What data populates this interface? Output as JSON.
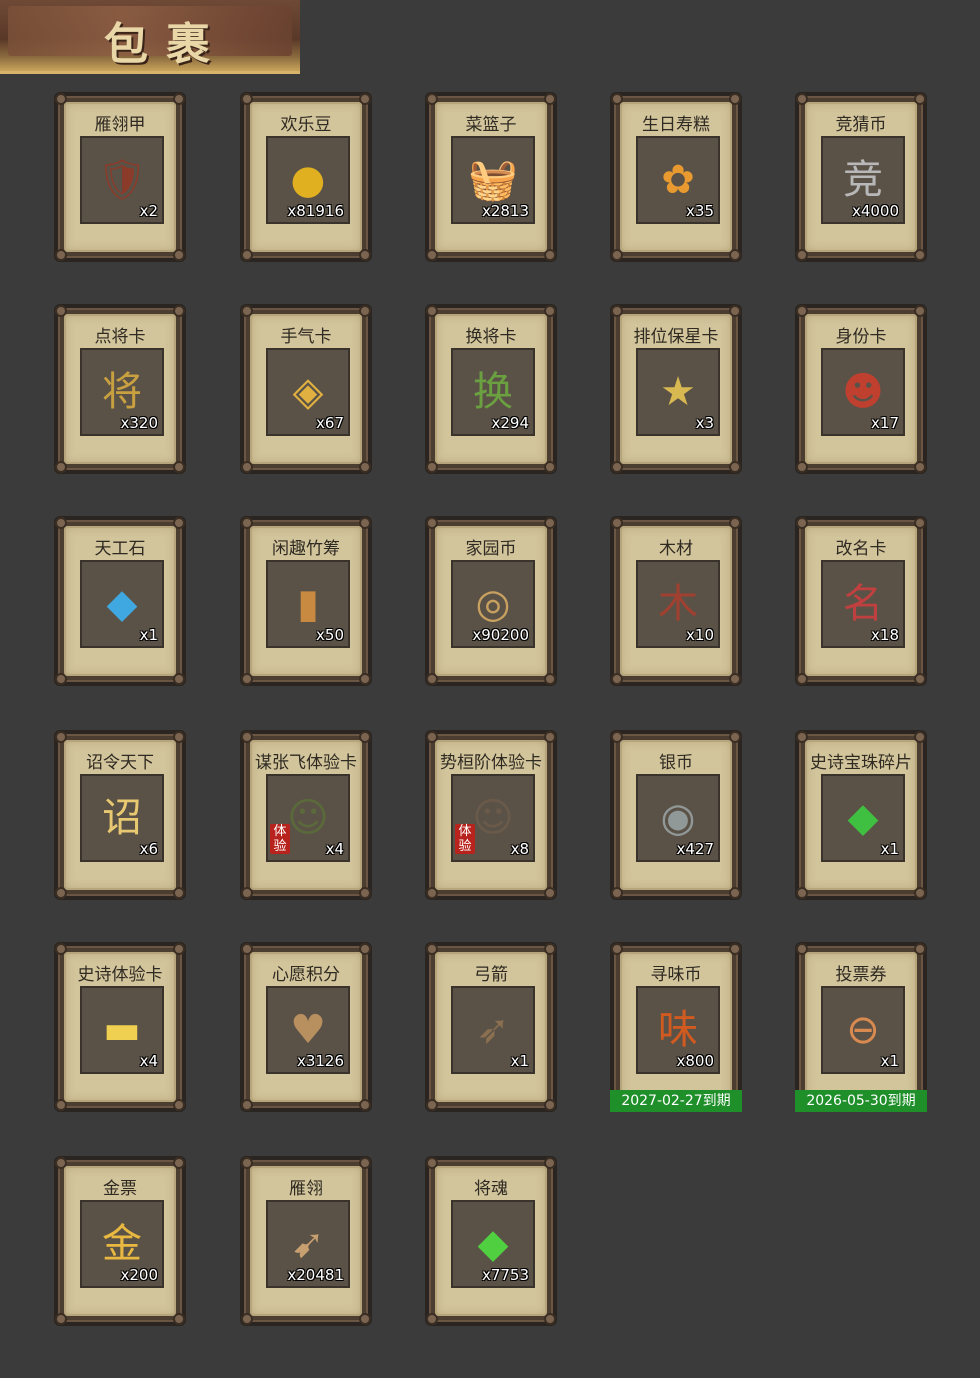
{
  "header": {
    "title": "包裹"
  },
  "items": [
    {
      "name": "雁翎甲",
      "qty": "x2",
      "icon": "armor-icon",
      "glyph": "🛡",
      "color": "#8a3b2a"
    },
    {
      "name": "欢乐豆",
      "qty": "x81916",
      "icon": "bean-icon",
      "glyph": "●",
      "color": "#e0b020"
    },
    {
      "name": "菜篮子",
      "qty": "x2813",
      "icon": "basket-icon",
      "glyph": "🧺",
      "color": "#a0522d"
    },
    {
      "name": "生日寿糕",
      "qty": "x35",
      "icon": "cake-icon",
      "glyph": "✿",
      "color": "#e89a30"
    },
    {
      "name": "竞猜币",
      "qty": "x4000",
      "icon": "silver-coin-icon",
      "glyph": "竞",
      "color": "#b8b8b8"
    },
    {
      "name": "点将卡",
      "qty": "x320",
      "icon": "general-card-icon",
      "glyph": "将",
      "color": "#c8a040"
    },
    {
      "name": "手气卡",
      "qty": "x67",
      "icon": "luck-card-icon",
      "glyph": "◈",
      "color": "#e0b040"
    },
    {
      "name": "换将卡",
      "qty": "x294",
      "icon": "swap-card-icon",
      "glyph": "换",
      "color": "#6aa040"
    },
    {
      "name": "排位保星卡",
      "qty": "x3",
      "icon": "rank-card-icon",
      "glyph": "★",
      "color": "#d8b850"
    },
    {
      "name": "身份卡",
      "qty": "x17",
      "icon": "identity-card-icon",
      "glyph": "☻",
      "color": "#c04030"
    },
    {
      "name": "天工石",
      "qty": "x1",
      "icon": "gem-icon",
      "glyph": "◆",
      "color": "#40a8e0"
    },
    {
      "name": "闲趣竹筹",
      "qty": "x50",
      "icon": "bamboo-token-icon",
      "glyph": "▮",
      "color": "#c88a40"
    },
    {
      "name": "家园币",
      "qty": "x90200",
      "icon": "home-coin-icon",
      "glyph": "◎",
      "color": "#c8a060"
    },
    {
      "name": "木材",
      "qty": "x10",
      "icon": "wood-icon",
      "glyph": "木",
      "color": "#a04030"
    },
    {
      "name": "改名卡",
      "qty": "x18",
      "icon": "rename-card-icon",
      "glyph": "名",
      "color": "#c04040"
    },
    {
      "name": "诏令天下",
      "qty": "x6",
      "icon": "scroll-icon",
      "glyph": "诏",
      "color": "#e8c870"
    },
    {
      "name": "谋张飞体验卡",
      "qty": "x4",
      "icon": "zhangfei-portrait-icon",
      "glyph": "☺",
      "color": "#5a6a3a",
      "tag": "体验"
    },
    {
      "name": "势桓阶体验卡",
      "qty": "x8",
      "icon": "huanjie-portrait-icon",
      "glyph": "☺",
      "color": "#6a5a4a",
      "tag": "体验"
    },
    {
      "name": "银币",
      "qty": "x427",
      "icon": "silver-coins-icon",
      "glyph": "◉",
      "color": "#909898"
    },
    {
      "name": "史诗宝珠碎片",
      "qty": "x1",
      "icon": "green-shard-icon",
      "glyph": "◆",
      "color": "#40c040"
    },
    {
      "name": "史诗体验卡",
      "qty": "x4",
      "icon": "epic-card-icon",
      "glyph": "▬",
      "color": "#f0d050"
    },
    {
      "name": "心愿积分",
      "qty": "x3126",
      "icon": "wish-coin-icon",
      "glyph": "♥",
      "color": "#b89060"
    },
    {
      "name": "弓箭",
      "qty": "x1",
      "icon": "bow-arrow-icon",
      "glyph": "➶",
      "color": "#8a7050"
    },
    {
      "name": "寻味币",
      "qty": "x800",
      "icon": "flavor-coin-icon",
      "glyph": "味",
      "color": "#d05a20",
      "expiry": "2027-02-27到期"
    },
    {
      "name": "投票券",
      "qty": "x1",
      "icon": "vote-ticket-icon",
      "glyph": "⊖",
      "color": "#d88a50",
      "expiry": "2026-05-30到期"
    },
    {
      "name": "金票",
      "qty": "x200",
      "icon": "gold-ticket-icon",
      "glyph": "金",
      "color": "#e8b840"
    },
    {
      "name": "雁翎",
      "qty": "x20481",
      "icon": "feather-icon",
      "glyph": "➹",
      "color": "#c8a070"
    },
    {
      "name": "将魂",
      "qty": "x7753",
      "icon": "soul-crystal-icon",
      "glyph": "◆",
      "color": "#50d040"
    }
  ]
}
